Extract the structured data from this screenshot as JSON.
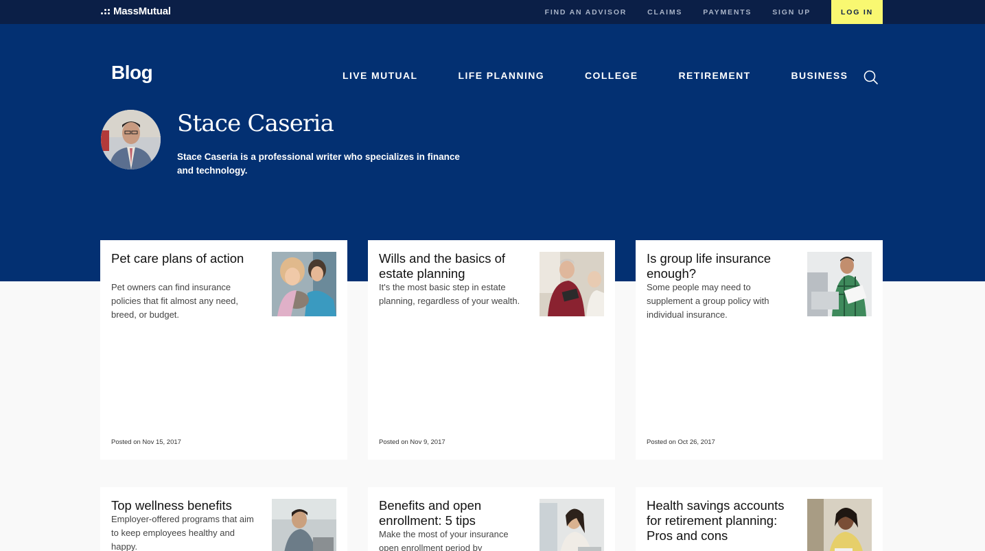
{
  "topbar": {
    "logo_text": "MassMutual",
    "links": [
      "FIND AN ADVISOR",
      "CLAIMS",
      "PAYMENTS",
      "SIGN UP"
    ],
    "login_label": "LOG IN"
  },
  "header": {
    "title": "Blog",
    "nav": [
      "LIVE MUTUAL",
      "LIFE PLANNING",
      "COLLEGE",
      "RETIREMENT",
      "BUSINESS"
    ],
    "search_icon": "search-icon"
  },
  "author": {
    "name": "Stace Caseria",
    "bio": "Stace Caseria is a professional writer who specializes in finance and technology."
  },
  "cards": [
    {
      "title": "Pet care plans of action",
      "desc": "Pet owners can find insurance policies that fit almost any need, breed, or budget.",
      "date": "Posted on Nov 15, 2017"
    },
    {
      "title": "Wills and the basics of estate planning",
      "desc": "It's the most basic step in estate planning, regardless of your wealth.",
      "date": "Posted on Nov 9, 2017"
    },
    {
      "title": "Is group life insurance enough?",
      "desc": "Some people may need to supplement a group policy with individual insurance.",
      "date": "Posted on Oct 26, 2017"
    },
    {
      "title": "Top wellness benefits",
      "desc": "Employer-offered programs that aim to keep employees healthy and happy.",
      "date": ""
    },
    {
      "title": "Benefits and open enrollment: 5 tips",
      "desc": "Make the most of your insurance open enrollment period by",
      "date": ""
    },
    {
      "title": "Health savings accounts for retirement planning: Pros and cons",
      "desc": "",
      "date": ""
    }
  ],
  "colors": {
    "topbar": "#0b1f47",
    "hero": "#033072",
    "login": "#f9f871"
  }
}
